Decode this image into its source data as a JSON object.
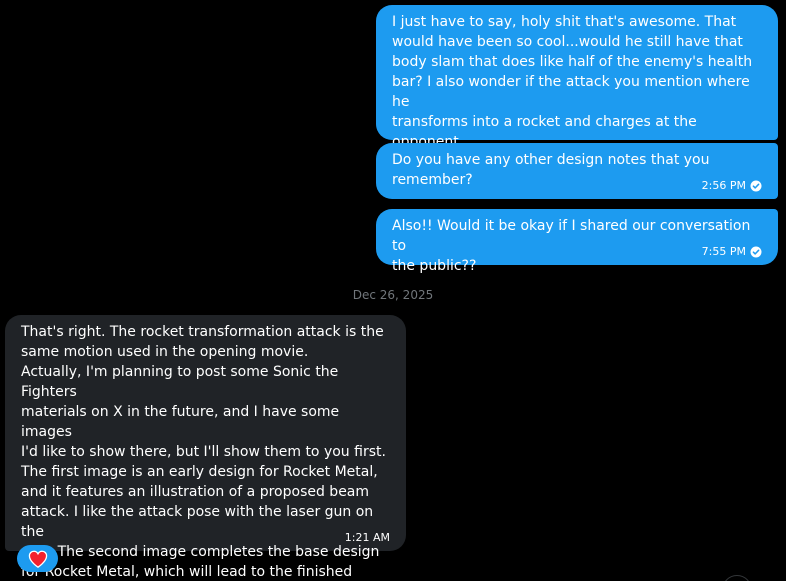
{
  "conversation": {
    "date_separator": "Dec 26, 2025",
    "messages": [
      {
        "direction": "sent",
        "lines": "I just have to say, holy shit that's awesome. That\nwould have been so cool...would he still have that\nbody slam that does like half of the enemy's health\nbar? I also wonder if the attack you mention where he\ntransforms into a rocket and charges at the opponent\nwas the one we see in the opening",
        "time": ""
      },
      {
        "direction": "sent",
        "lines": "Do you have any other design notes that you\nremember?",
        "time": "2:56 PM"
      },
      {
        "direction": "sent",
        "lines": "Also!! Would it be okay if I shared our conversation to\nthe public??",
        "time": "7:55 PM"
      },
      {
        "direction": "received",
        "lines": "That's right. The rocket transformation attack is the\nsame motion used in the opening movie.\nActually, I'm planning to post some Sonic the Fighters\nmaterials on X in the future, and I have some images\nI'd like to show there, but I'll show them to you first.\nThe first image is an early design for Rocket Metal,\nand it features an illustration of a proposed beam\nattack. I like the attack pose with the laser gun on the\narm. The second image completes the base design\nfor Rocket Metal, which will lead to the finished\nmodel.👇",
        "time": "1:21 AM"
      }
    ],
    "reaction": {
      "emoji_icon": "heart-icon",
      "count": ""
    }
  },
  "colors": {
    "background": "#000000",
    "sent_bubble": "#1d9bf0",
    "received_bubble": "#202327",
    "muted_text": "#71767b",
    "heart": "#f4212e"
  }
}
